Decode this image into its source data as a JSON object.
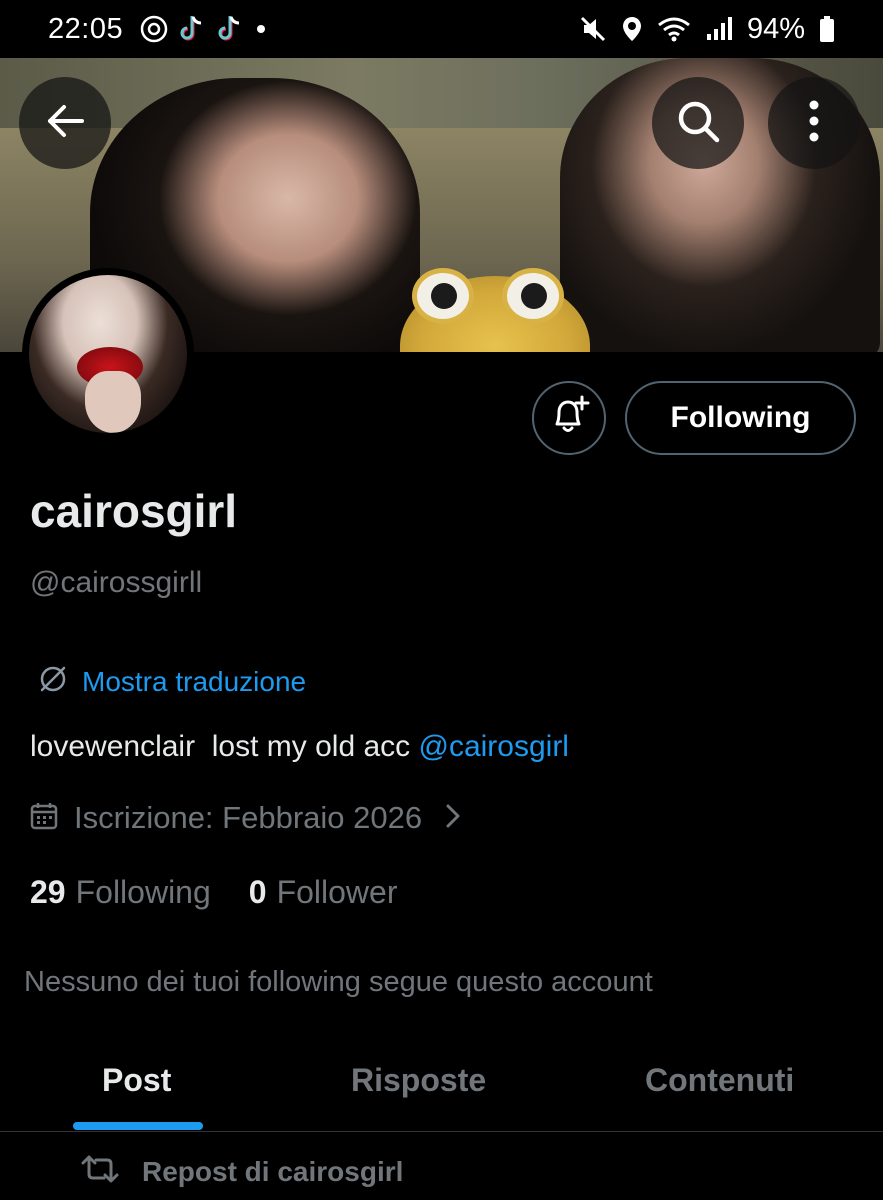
{
  "status_bar": {
    "time": "22:05",
    "battery": "94%",
    "left_icons": [
      "threads-icon",
      "tiktok-icon",
      "tiktok-icon",
      "dot-icon"
    ],
    "right_icons": [
      "mute-icon",
      "location-icon",
      "wifi-icon",
      "signal-icon",
      "battery-icon"
    ]
  },
  "header": {
    "back_icon": "arrow-left-icon",
    "search_icon": "search-icon",
    "more_icon": "more-vertical-icon"
  },
  "profile": {
    "display_name": "cairosgirl",
    "handle": "@cairossgirll",
    "translate_label": "Mostra traduzione",
    "bio_text": "lovewenclair  lost my old acc ",
    "bio_mention": "@cairosgirl",
    "joined": "Iscrizione: Febbraio 2026",
    "following_count": "29",
    "following_label": "Following",
    "followers_count": "0",
    "followers_label": "Follower",
    "mutuals_note": "Nessuno dei tuoi following segue questo account"
  },
  "actions": {
    "follow_button": "Following",
    "bell_icon": "bell-plus-icon"
  },
  "tabs": [
    {
      "label": "Post",
      "active": true
    },
    {
      "label": "Risposte",
      "active": false
    },
    {
      "label": "Contenuti",
      "active": false
    }
  ],
  "feed": {
    "repost_label": "Repost di cairosgirl"
  },
  "colors": {
    "accent": "#1d9bf0",
    "background": "#000000",
    "muted": "#71767b",
    "text": "#e7e9ea"
  }
}
